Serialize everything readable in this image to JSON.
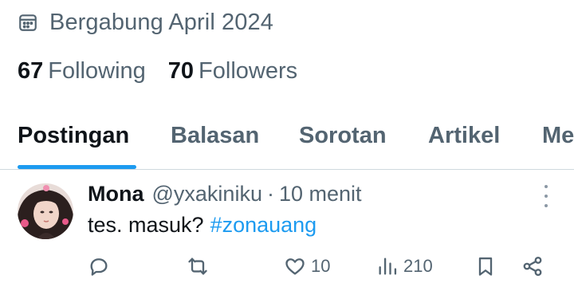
{
  "profile": {
    "joined_text": "Bergabung April 2024",
    "following_count": "67",
    "following_label": "Following",
    "followers_count": "70",
    "followers_label": "Followers"
  },
  "tabs": [
    {
      "label": "Postingan",
      "active": true
    },
    {
      "label": "Balasan",
      "active": false
    },
    {
      "label": "Sorotan",
      "active": false
    },
    {
      "label": "Artikel",
      "active": false
    },
    {
      "label": "Me",
      "active": false
    }
  ],
  "tweet": {
    "author_name": "Mona",
    "handle": "@yxakiniku",
    "separator": "·",
    "time": "10 menit",
    "text": "tes. masuk?",
    "hashtag": "#zonauang",
    "likes": "10",
    "views": "210"
  },
  "icons": {
    "joined": "calendar-icon",
    "reply": "reply-icon",
    "retweet": "retweet-icon",
    "like": "heart-icon",
    "views": "views-icon",
    "bookmark": "bookmark-icon",
    "share": "share-icon",
    "more": "more-vertical-icon"
  },
  "colors": {
    "accent": "#1d9bf0",
    "secondary_text": "#536471",
    "primary_text": "#0f1419",
    "divider": "#cfd9de"
  }
}
